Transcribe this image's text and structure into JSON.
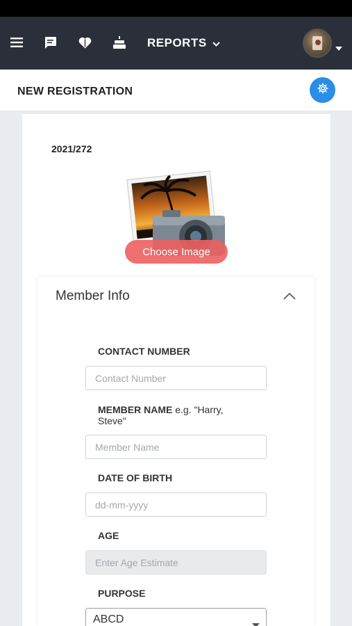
{
  "navbar": {
    "icons": [
      "menu-icon",
      "chat-icon",
      "heart-icon",
      "cake-icon"
    ],
    "reports_label": "REPORTS"
  },
  "header": {
    "title": "NEW REGISTRATION",
    "settings_icon": "gear-icon"
  },
  "registration": {
    "number": "2021/272",
    "choose_image_label": "Choose Image"
  },
  "member_info": {
    "title": "Member Info",
    "contact": {
      "label": "CONTACT NUMBER",
      "placeholder": "Contact Number"
    },
    "name": {
      "label": "MEMBER NAME",
      "hint": " e.g. \"Harry, Steve\"",
      "placeholder": "Member Name"
    },
    "dob": {
      "label": "DATE OF BIRTH",
      "placeholder": "dd-mm-yyyy"
    },
    "age": {
      "label": "AGE",
      "placeholder": "Enter Age Estimate"
    },
    "purpose": {
      "label": "PURPOSE",
      "selected": "ABCD"
    }
  },
  "colors": {
    "navbar_bg": "#2b2f3a",
    "accent_blue": "#2a8de6",
    "choose_image_bg": "#ec6060"
  }
}
